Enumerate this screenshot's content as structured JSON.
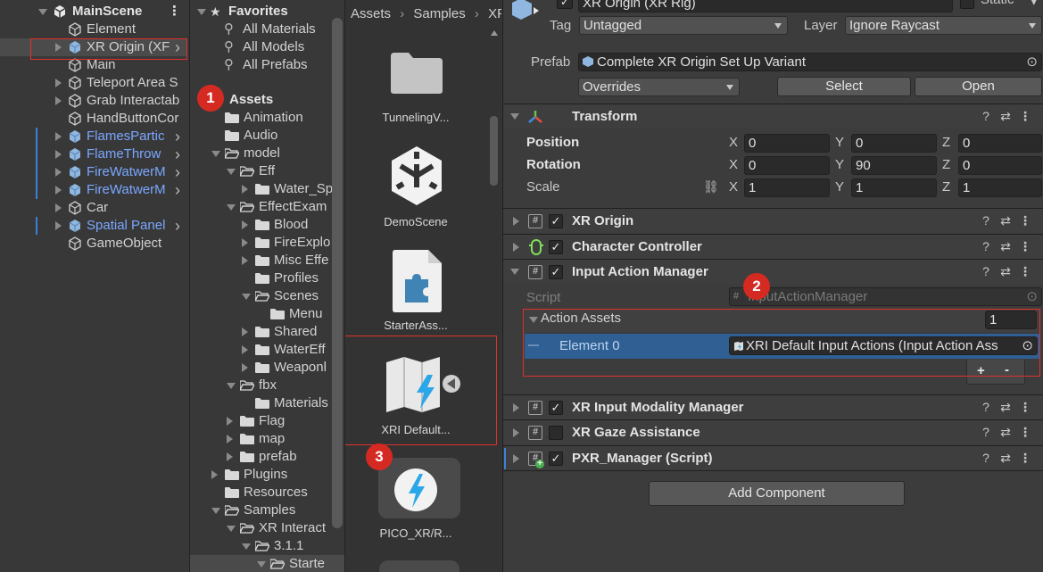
{
  "hierarchy": {
    "scene": "MainScene",
    "items": [
      {
        "label": "Element",
        "blue": false
      },
      {
        "label": "XR Origin (XF",
        "blue": false
      },
      {
        "label": "Main",
        "blue": false
      },
      {
        "label": "Teleport Area S",
        "blue": false
      },
      {
        "label": "Grab Interactab",
        "blue": false
      },
      {
        "label": "HandButtonCor",
        "blue": false
      },
      {
        "label": "FlamesPartic",
        "blue": true
      },
      {
        "label": "FlameThrow",
        "blue": true
      },
      {
        "label": "FireWatwerM",
        "blue": true
      },
      {
        "label": "FireWatwerM",
        "blue": true
      },
      {
        "label": "Car",
        "blue": false
      },
      {
        "label": "Spatial Panel",
        "blue": true
      },
      {
        "label": "GameObject",
        "blue": false
      }
    ]
  },
  "project": {
    "favorites_title": "Favorites",
    "favorites": [
      "All Materials",
      "All Models",
      "All Prefabs"
    ],
    "assets_title": "Assets",
    "tree": [
      "Animation",
      "Audio",
      "model",
      "Eff",
      "Water_Sp",
      "EffectExam",
      "Blood",
      "FireExplo",
      "Misc Effe",
      "Profiles",
      "Scenes",
      "Menu",
      "Shared",
      "WaterEff",
      "Weaponl",
      "fbx",
      "Materials",
      "Flag",
      "map",
      "prefab",
      "Plugins",
      "Resources",
      "Samples",
      "XR Interact",
      "3.1.1",
      "Starte"
    ]
  },
  "grid": {
    "breadcrumb": [
      "Assets",
      "Samples",
      "XF"
    ],
    "tiles": [
      "TunnelingV...",
      "DemoScene",
      "StarterAss...",
      "XRI Default...",
      "PICO_XR/R..."
    ]
  },
  "inspector": {
    "object_name": "XR Origin (XR Rig)",
    "static_label": "Static",
    "tag_label": "Tag",
    "tag_value": "Untagged",
    "layer_label": "Layer",
    "layer_value": "Ignore Raycast",
    "prefab_label": "Prefab",
    "prefab_value": "Complete XR Origin Set Up Variant",
    "overrides": "Overrides",
    "select": "Select",
    "open": "Open",
    "transform": {
      "title": "Transform",
      "position_label": "Position",
      "rotation_label": "Rotation",
      "scale_label": "Scale",
      "position": {
        "x": "0",
        "y": "0",
        "z": "0"
      },
      "rotation": {
        "x": "0",
        "y": "90",
        "z": "0"
      },
      "scale": {
        "x": "1",
        "y": "1",
        "z": "1"
      },
      "axis_x": "X",
      "axis_y": "Y",
      "axis_z": "Z"
    },
    "components": {
      "xr_origin": "XR Origin",
      "character_controller": "Character Controller",
      "input_action_manager": "Input Action Manager",
      "xr_input_modality_manager": "XR Input Modality Manager",
      "xr_gaze_assistance": "XR Gaze Assistance",
      "pxr_manager": "PXR_Manager (Script)"
    },
    "script_label": "Script",
    "script_value": "InputActionManager",
    "action_assets_label": "Action Assets",
    "action_assets_count": "1",
    "element0_label": "Element 0",
    "element0_value": "XRI Default Input Actions (Input Action Ass",
    "plus": "+",
    "minus": "-",
    "add_component": "Add Component"
  },
  "annotations": [
    "1",
    "2",
    "3"
  ]
}
